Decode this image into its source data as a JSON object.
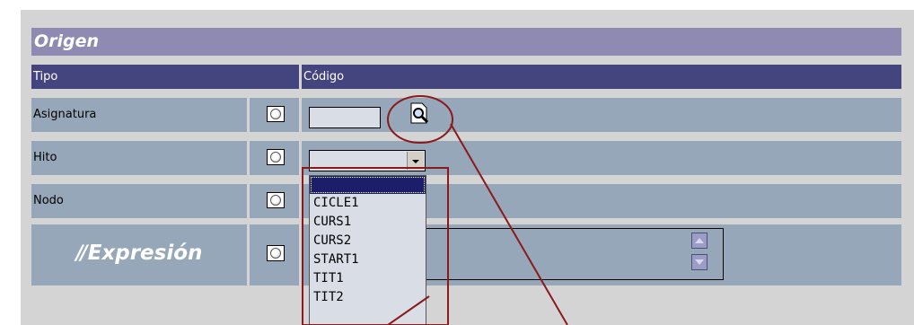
{
  "section_title": "Origen",
  "columns": {
    "tipo": "Tipo",
    "codigo": "Código"
  },
  "rows": [
    {
      "label": "Asignatura"
    },
    {
      "label": "Hito"
    },
    {
      "label": "Nodo"
    }
  ],
  "expression": {
    "label": "Expresión"
  },
  "dropdown_options": [
    "",
    "CICLE1",
    "CURS1",
    "CURS2",
    "START1",
    "TIT1",
    "TIT2"
  ],
  "colors": {
    "header_bg": "#8e8ab2",
    "column_header_bg": "#44457e",
    "row_bg": "#95a7b8",
    "annotation": "#8b1a1a"
  },
  "icons": {
    "search": "magnifier-document-icon",
    "dropdown": "chevron-down-icon"
  }
}
